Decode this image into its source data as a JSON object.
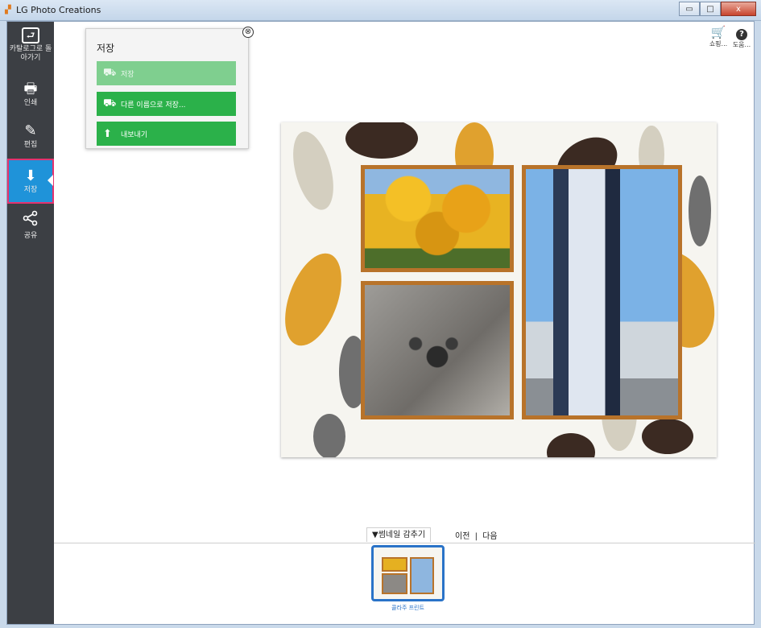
{
  "window": {
    "title": "LG Photo Creations",
    "minimize_glyph": "▭",
    "maximize_glyph": "□",
    "close_glyph": "x"
  },
  "sidebar": {
    "items": [
      {
        "id": "back",
        "label": "카탈로그로 돌아가기",
        "icon": "back-icon",
        "glyph": "⮐"
      },
      {
        "id": "print",
        "label": "인쇄",
        "icon": "printer-icon",
        "glyph": "🖶"
      },
      {
        "id": "edit",
        "label": "편집",
        "icon": "pencil-icon",
        "glyph": "✎"
      },
      {
        "id": "save",
        "label": "저장",
        "icon": "save-icon",
        "glyph": "⬇",
        "active": true
      },
      {
        "id": "share",
        "label": "공유",
        "icon": "share-icon",
        "glyph": "<"
      }
    ],
    "active_color": "#1f93d9",
    "highlight_border": "#e5326e"
  },
  "save_popup": {
    "title": "저장",
    "close_glyph": "⊗",
    "buttons": [
      {
        "label": "저장",
        "icon": "save-tray-icon",
        "enabled": false
      },
      {
        "label": "다른 이름으로 저장...",
        "icon": "save-as-tray-icon",
        "enabled": true
      },
      {
        "label": "내보내기",
        "icon": "export-icon",
        "enabled": true
      }
    ],
    "button_color": "#2bb14a"
  },
  "toolbar": {
    "shop_label": "쇼핑...",
    "help_label": "도움...",
    "help_glyph": "?",
    "cart_glyph": "🛒"
  },
  "thumbnails": {
    "toggle_label": "▼썸네일 감추기",
    "prev_label": "이전",
    "separator": "|",
    "next_label": "다음",
    "items": [
      {
        "caption": "콜라주 프린트",
        "selected": true
      }
    ]
  }
}
